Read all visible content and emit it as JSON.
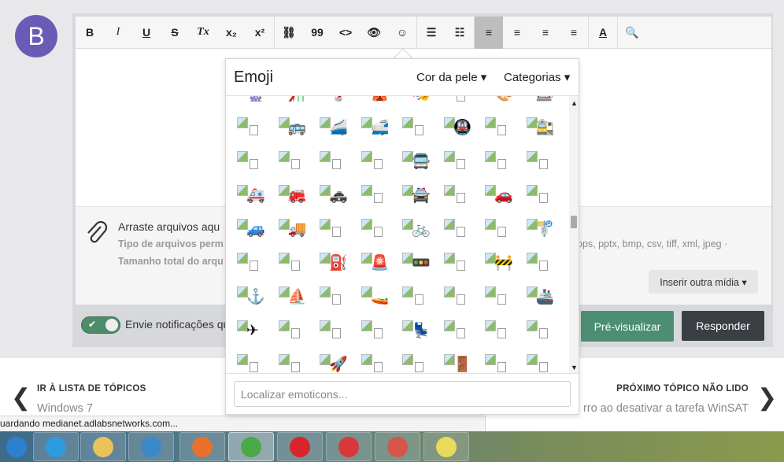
{
  "avatar": {
    "letter": "B",
    "color": "#6b5bb6"
  },
  "toolbar": {
    "buttons": [
      {
        "name": "bold",
        "label": "B"
      },
      {
        "name": "italic",
        "label": "I"
      },
      {
        "name": "underline",
        "label": "U"
      },
      {
        "name": "strikethrough",
        "label": "S"
      },
      {
        "name": "clear-format",
        "label": "Tx"
      },
      {
        "name": "subscript",
        "label": "x₂"
      },
      {
        "name": "superscript",
        "label": "x²"
      },
      {
        "name": "link",
        "label": "⛓"
      },
      {
        "name": "quote",
        "label": "99"
      },
      {
        "name": "code",
        "label": "<>"
      },
      {
        "name": "spoiler",
        "label": "👁"
      },
      {
        "name": "emoji",
        "label": "☺"
      },
      {
        "name": "bullet-list",
        "label": "☰"
      },
      {
        "name": "numbered-list",
        "label": "☷"
      },
      {
        "name": "align-left",
        "label": "≡"
      },
      {
        "name": "align-center",
        "label": "≡"
      },
      {
        "name": "align-right",
        "label": "≡"
      },
      {
        "name": "justify",
        "label": "≡"
      },
      {
        "name": "text-color",
        "label": "A"
      },
      {
        "name": "preview-source",
        "label": "🔍"
      }
    ],
    "active": "align-left"
  },
  "attachments": {
    "title": "Arraste arquivos aqu",
    "types": "Tipo de arquivos perm",
    "types_cont": "pps, pptx, bmp, csv, tiff, xml, jpeg ·",
    "size": "Tamanho total do arqu",
    "insert_media": "Inserir outra mídia ▾"
  },
  "footer": {
    "notify": "Envie notificações qu",
    "preview": "Pré-visualizar",
    "reply": "Responder"
  },
  "emoji_panel": {
    "title": "Emoji",
    "skin_tone": "Cor da pele ▾",
    "categories": "Categorias ▾",
    "search_placeholder": "Localizar emoticons...",
    "rows": [
      [
        "🎡",
        "🎢",
        "💈",
        "🎪",
        "🎭",
        "",
        "🎨",
        "🎰"
      ],
      [
        "",
        "🚌",
        "🚄",
        "🚅",
        "",
        "🚇",
        "",
        "🚉"
      ],
      [
        "",
        "",
        "",
        "",
        "🚍",
        "",
        "",
        ""
      ],
      [
        "🚑",
        "🚒",
        "🚓",
        "",
        "🚔",
        "",
        "🚗",
        ""
      ],
      [
        "🚙",
        "🚚",
        "",
        "",
        "🚲",
        "",
        "",
        "🚏"
      ],
      [
        "",
        "",
        "⛽",
        "🚨",
        "🚥",
        "",
        "🚧",
        ""
      ],
      [
        "⚓",
        "⛵",
        "",
        "🚤",
        "",
        "",
        "",
        "🚢"
      ],
      [
        "✈",
        "",
        "",
        "",
        "💺",
        "",
        "",
        ""
      ],
      [
        "",
        "",
        "🚀",
        "",
        "",
        "🚪",
        "",
        ""
      ]
    ]
  },
  "nav": {
    "prev_label": "IR À LISTA DE TÓPICOS",
    "prev_title": "Windows 7",
    "next_label": "PRÓXIMO TÓPICO NÃO LIDO",
    "next_title": "rro ao desativar a tarefa WinSAT"
  },
  "statusbar": "uardando medianet.adlabsnetworks.com...",
  "taskbar": {
    "apps": [
      "start-orb",
      "internet-explorer",
      "file-explorer",
      "media-player",
      "firefox",
      "chrome",
      "opera",
      "vivaldi",
      "snipping-tool",
      "sticky-notes"
    ]
  }
}
